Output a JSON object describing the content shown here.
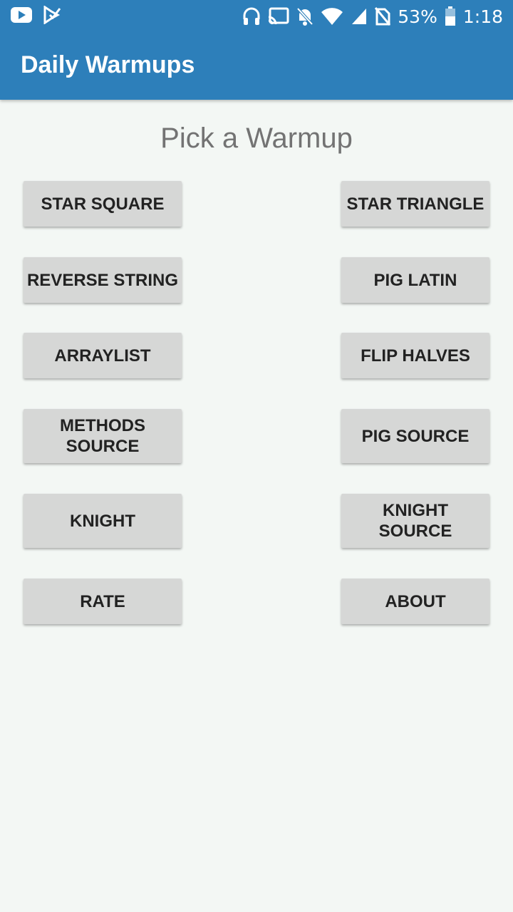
{
  "status_bar": {
    "battery": "53%",
    "time": "1:18",
    "icons": [
      "youtube-icon",
      "play-check-icon",
      "headphones-icon",
      "cast-icon",
      "notifications-off-icon",
      "wifi-icon",
      "signal-icon",
      "no-sim-icon",
      "battery-icon"
    ]
  },
  "app_bar": {
    "title": "Daily Warmups",
    "color": "#2d7fba"
  },
  "main": {
    "heading": "Pick a Warmup",
    "buttons": {
      "star_square": "STAR SQUARE",
      "star_triangle": "STAR TRIANGLE",
      "reverse_string": "REVERSE STRING",
      "pig_latin": "PIG LATIN",
      "arraylist": "ARRAYLIST",
      "flip_halves": "FLIP HALVES",
      "methods_source": "METHODS\nSOURCE",
      "pig_source": "PIG SOURCE",
      "knight": "KNIGHT",
      "knight_source": "KNIGHT\nSOURCE",
      "rate": "RATE",
      "about": "ABOUT"
    }
  }
}
